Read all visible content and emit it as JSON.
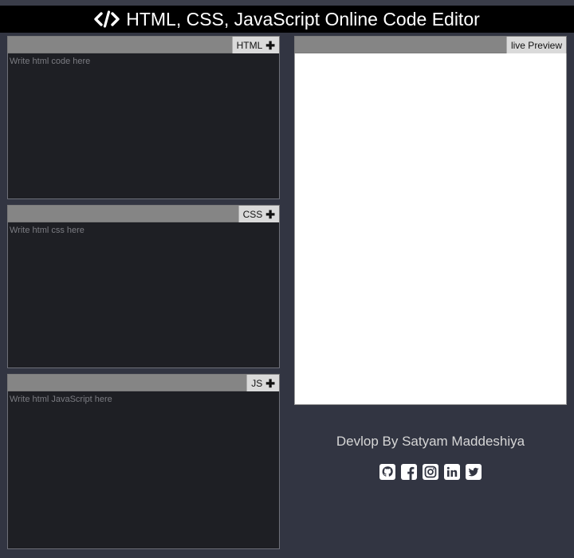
{
  "header": {
    "title": "HTML, CSS, JavaScript Online Code Editor",
    "icon": "code-icon"
  },
  "editors": {
    "html": {
      "tab_label": "HTML",
      "placeholder": "Write html code here"
    },
    "css": {
      "tab_label": "CSS",
      "placeholder": "Write html css here"
    },
    "js": {
      "tab_label": "JS",
      "placeholder": "Write html JavaScript here"
    }
  },
  "preview": {
    "tab_label": "live Preview"
  },
  "footer": {
    "credit": "Devlop By Satyam Maddeshiya",
    "socials": [
      "github-icon",
      "facebook-icon",
      "instagram-icon",
      "linkedin-icon",
      "twitter-icon"
    ]
  },
  "colors": {
    "background": "#323542",
    "header": "#000000",
    "editor": "#1e1f24",
    "bar": "#858585",
    "tab": "#dadada"
  }
}
